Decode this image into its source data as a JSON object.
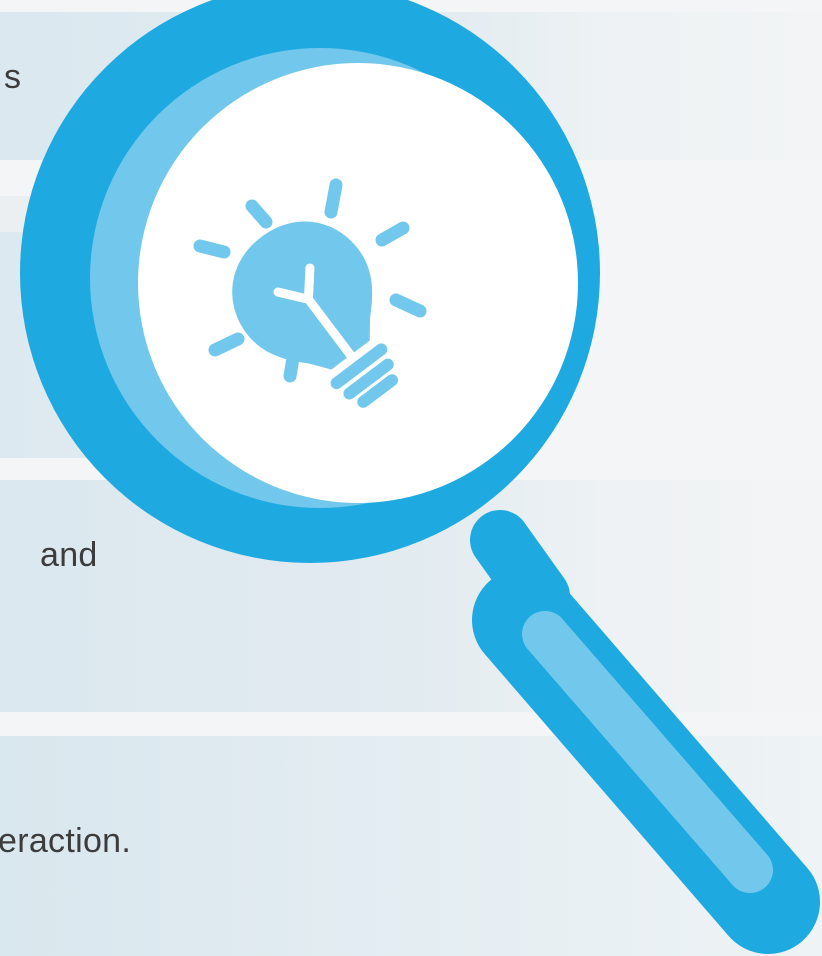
{
  "panels": [
    {
      "text": "s"
    },
    {
      "text": ""
    },
    {
      "text": "and"
    },
    {
      "text": "eraction."
    }
  ],
  "illustration": {
    "icon": "magnifying-glass-lightbulb-icon",
    "colors": {
      "ring": "#1fa9e1",
      "light_blue": "#72c8ec",
      "lens": "#ffffff",
      "background": "#f4f5f6",
      "panel": "#dfeaf0",
      "text": "#3c3c3c"
    }
  }
}
